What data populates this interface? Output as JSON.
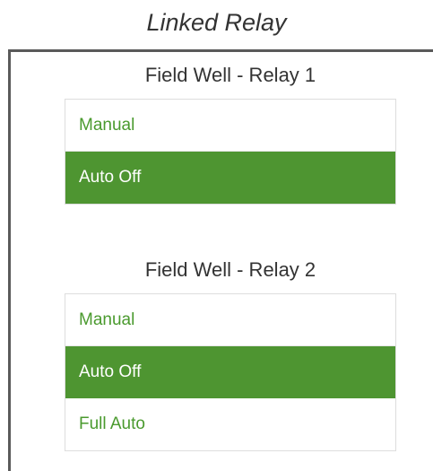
{
  "caption": "Linked Relay",
  "groups": [
    {
      "title": "Field Well - Relay 1",
      "options": [
        {
          "label": "Manual",
          "selected": false
        },
        {
          "label": "Auto Off",
          "selected": true
        }
      ]
    },
    {
      "title": "Field Well - Relay 2",
      "options": [
        {
          "label": "Manual",
          "selected": false
        },
        {
          "label": "Auto Off",
          "selected": true
        },
        {
          "label": "Full Auto",
          "selected": false
        }
      ]
    }
  ],
  "colors": {
    "accent": "#4e9531",
    "option_text": "#4a9a2e",
    "border": "#5a5a5a"
  }
}
